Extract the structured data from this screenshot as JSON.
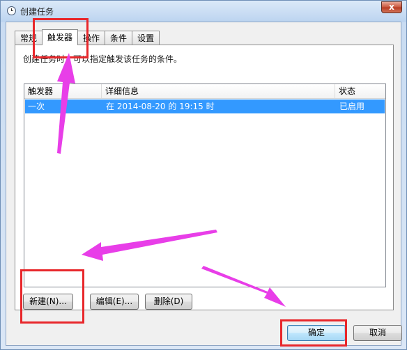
{
  "window": {
    "title": "创建任务",
    "close_glyph": "x"
  },
  "tabs": [
    {
      "label": "常规",
      "active": false
    },
    {
      "label": "触发器",
      "active": true
    },
    {
      "label": "操作",
      "active": false
    },
    {
      "label": "条件",
      "active": false
    },
    {
      "label": "设置",
      "active": false
    }
  ],
  "panel": {
    "description": "创建任务时，可以指定触发该任务的条件。"
  },
  "table": {
    "columns": [
      "触发器",
      "详细信息",
      "状态"
    ],
    "rows": [
      {
        "trigger": "一次",
        "details": "在 2014-08-20 的 19:15 时",
        "status": "已启用",
        "selected": true
      }
    ]
  },
  "buttons": {
    "new": "新建(N)...",
    "edit": "编辑(E)...",
    "delete": "删除(D)",
    "ok": "确定",
    "cancel": "取消"
  },
  "colors": {
    "annotation_arrow": "#e83ee8",
    "annotation_box": "#e8272b",
    "selection": "#3399ff"
  },
  "icons": {
    "title": "clock-icon",
    "close": "close-icon"
  }
}
